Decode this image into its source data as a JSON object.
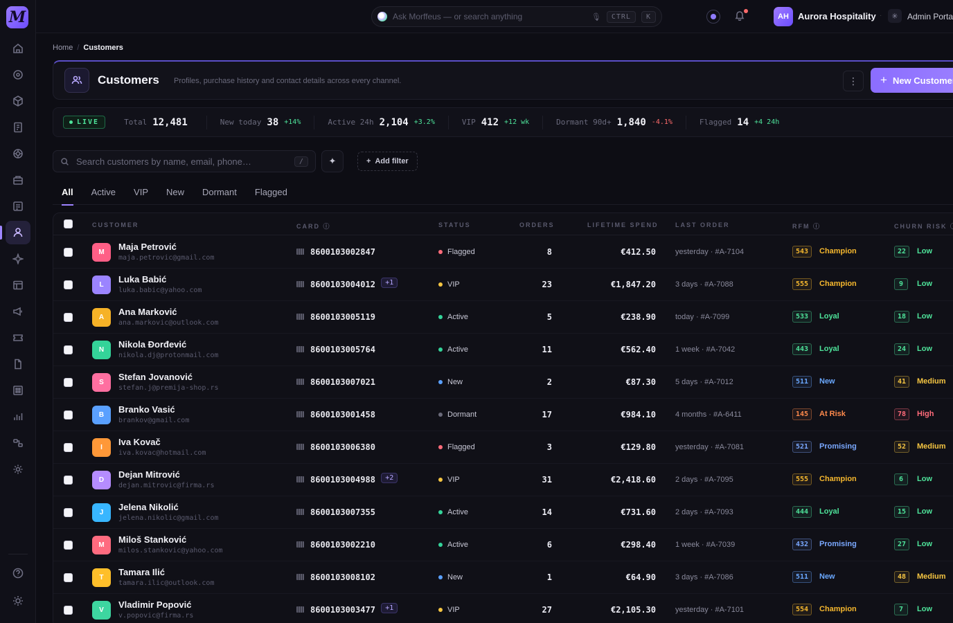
{
  "brand": {
    "logo_letter": "M"
  },
  "topbar": {
    "ask_placeholder": "Ask Morffeus — or search anything",
    "kbd_ctrl": "CTRL",
    "kbd_k": "K",
    "org_initials": "AH",
    "org_name": "Aurora Hospitality",
    "admin_label": "Admin Portal"
  },
  "breadcrumb": {
    "home": "Home",
    "separator": "/",
    "current": "Customers"
  },
  "header": {
    "title": "Customers",
    "subtitle": "Profiles, purchase history and contact details across every channel.",
    "more": "⋮",
    "new_button": "New Customer"
  },
  "stats": {
    "live": "LIVE",
    "items": [
      {
        "label": "Total",
        "value": "12,481",
        "delta": "",
        "trend": "none"
      },
      {
        "label": "New today",
        "value": "38",
        "delta": "+14%",
        "trend": "pos"
      },
      {
        "label": "Active 24h",
        "value": "2,104",
        "delta": "+3.2%",
        "trend": "pos"
      },
      {
        "label": "VIP",
        "value": "412",
        "delta": "+12 wk",
        "trend": "pos"
      },
      {
        "label": "Dormant 90d+",
        "value": "1,840",
        "delta": "-4.1%",
        "trend": "neg"
      },
      {
        "label": "Flagged",
        "value": "14",
        "delta": "+4 24h",
        "trend": "pos"
      }
    ]
  },
  "search": {
    "placeholder": "Search customers by name, email, phone…",
    "shortcut": "/"
  },
  "filters": {
    "add_filter": "Add filter"
  },
  "tabs": [
    "All",
    "Active",
    "VIP",
    "New",
    "Dormant",
    "Flagged"
  ],
  "table": {
    "columns": {
      "customer": "CUSTOMER",
      "card": "CARD",
      "status": "STATUS",
      "orders": "ORDERS",
      "spend": "LIFETIME SPEND",
      "last_order": "LAST ORDER",
      "rfm": "RFM",
      "churn": "CHURN RISK"
    },
    "rows": [
      {
        "initial": "M",
        "color": "#ff5f86",
        "name": "Maja Petrović",
        "email": "maja.petrovic@gmail.com",
        "card": "8600103002847",
        "extra": "",
        "status": "Flagged",
        "orders": "8",
        "spend": "€412.50",
        "last": "yesterday · #A-7104",
        "rfm": "543",
        "rfm_label": "Champion",
        "churn": "22",
        "churn_label": "Low"
      },
      {
        "initial": "L",
        "color": "#9b84ff",
        "name": "Luka Babić",
        "email": "luka.babic@yahoo.com",
        "card": "8600103004012",
        "extra": "+1",
        "status": "VIP",
        "orders": "23",
        "spend": "€1,847.20",
        "last": "3 days · #A-7088",
        "rfm": "555",
        "rfm_label": "Champion",
        "churn": "9",
        "churn_label": "Low"
      },
      {
        "initial": "A",
        "color": "#f6b227",
        "name": "Ana Marković",
        "email": "ana.markovic@outlook.com",
        "card": "8600103005119",
        "extra": "",
        "status": "Active",
        "orders": "5",
        "spend": "€238.90",
        "last": "today · #A-7099",
        "rfm": "533",
        "rfm_label": "Loyal",
        "churn": "18",
        "churn_label": "Low"
      },
      {
        "initial": "N",
        "color": "#34d399",
        "name": "Nikola Đorđević",
        "email": "nikola.dj@protonmail.com",
        "card": "8600103005764",
        "extra": "",
        "status": "Active",
        "orders": "11",
        "spend": "€562.40",
        "last": "1 week · #A-7042",
        "rfm": "443",
        "rfm_label": "Loyal",
        "churn": "24",
        "churn_label": "Low"
      },
      {
        "initial": "S",
        "color": "#ff6fa0",
        "name": "Stefan Jovanović",
        "email": "stefan.j@premija-shop.rs",
        "card": "8600103007021",
        "extra": "",
        "status": "New",
        "orders": "2",
        "spend": "€87.30",
        "last": "5 days · #A-7012",
        "rfm": "511",
        "rfm_label": "New",
        "churn": "41",
        "churn_label": "Medium"
      },
      {
        "initial": "B",
        "color": "#5aa0ff",
        "name": "Branko Vasić",
        "email": "brankov@gmail.com",
        "card": "8600103001458",
        "extra": "",
        "status": "Dormant",
        "orders": "17",
        "spend": "€984.10",
        "last": "4 months · #A-6411",
        "rfm": "145",
        "rfm_label": "At Risk",
        "churn": "78",
        "churn_label": "High"
      },
      {
        "initial": "I",
        "color": "#ff9838",
        "name": "Iva Kovač",
        "email": "iva.kovac@hotmail.com",
        "card": "8600103006380",
        "extra": "",
        "status": "Flagged",
        "orders": "3",
        "spend": "€129.80",
        "last": "yesterday · #A-7081",
        "rfm": "521",
        "rfm_label": "Promising",
        "churn": "52",
        "churn_label": "Medium"
      },
      {
        "initial": "D",
        "color": "#b58cff",
        "name": "Dejan Mitrović",
        "email": "dejan.mitrovic@firma.rs",
        "card": "8600103004988",
        "extra": "+2",
        "status": "VIP",
        "orders": "31",
        "spend": "€2,418.60",
        "last": "2 days · #A-7095",
        "rfm": "555",
        "rfm_label": "Champion",
        "churn": "6",
        "churn_label": "Low"
      },
      {
        "initial": "J",
        "color": "#38b6ff",
        "name": "Jelena Nikolić",
        "email": "jelena.nikolic@gmail.com",
        "card": "8600103007355",
        "extra": "",
        "status": "Active",
        "orders": "14",
        "spend": "€731.60",
        "last": "2 days · #A-7093",
        "rfm": "444",
        "rfm_label": "Loyal",
        "churn": "15",
        "churn_label": "Low"
      },
      {
        "initial": "M",
        "color": "#ff6b7f",
        "name": "Miloš Stanković",
        "email": "milos.stankovic@yahoo.com",
        "card": "8600103002210",
        "extra": "",
        "status": "Active",
        "orders": "6",
        "spend": "€298.40",
        "last": "1 week · #A-7039",
        "rfm": "432",
        "rfm_label": "Promising",
        "churn": "27",
        "churn_label": "Low"
      },
      {
        "initial": "T",
        "color": "#ffbf2a",
        "name": "Tamara Ilić",
        "email": "tamara.ilic@outlook.com",
        "card": "8600103008102",
        "extra": "",
        "status": "New",
        "orders": "1",
        "spend": "€64.90",
        "last": "3 days · #A-7086",
        "rfm": "511",
        "rfm_label": "New",
        "churn": "48",
        "churn_label": "Medium"
      },
      {
        "initial": "V",
        "color": "#3dd6a0",
        "name": "Vladimir Popović",
        "email": "v.popovic@firma.rs",
        "card": "8600103003477",
        "extra": "+1",
        "status": "VIP",
        "orders": "27",
        "spend": "€2,105.30",
        "last": "yesterday · #A-7101",
        "rfm": "554",
        "rfm_label": "Champion",
        "churn": "7",
        "churn_label": "Low"
      }
    ]
  },
  "colors": {
    "accent": "#9d82ff",
    "status": {
      "Flagged": "#ff6b7a",
      "VIP": "#f5c542",
      "Active": "#34d399",
      "New": "#5aa0ff",
      "Dormant": "#6a6a7a"
    },
    "rfm": {
      "Champion": "#f5b72e",
      "Loyal": "#4ee39a",
      "New": "#6aa8ff",
      "At Risk": "#ff8a4c",
      "Promising": "#7aa8ff"
    },
    "churn": {
      "Low": "#4ee39a",
      "Medium": "#f5c542",
      "High": "#ff6b7a"
    }
  }
}
